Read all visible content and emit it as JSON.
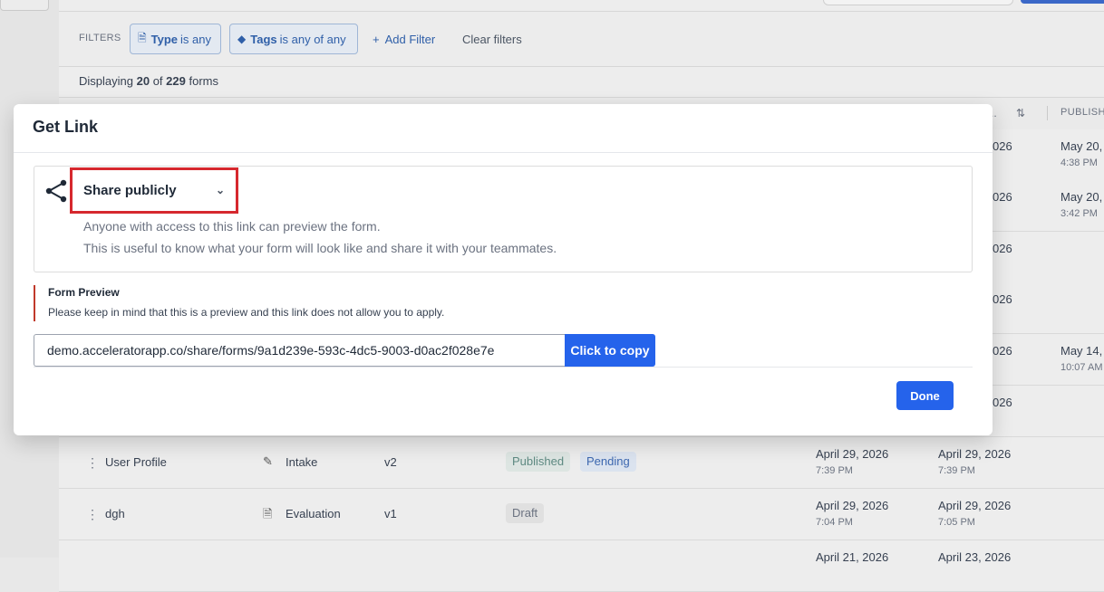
{
  "filters": {
    "label": "FILTERS",
    "type_chip": {
      "key": "Type",
      "rest": "is any",
      "icon": "document-icon"
    },
    "tags_chip": {
      "key": "Tags",
      "rest": "is any of any",
      "icon": "tag-icon"
    },
    "add_filter": "Add Filter",
    "clear_filters": "Clear filters"
  },
  "display": {
    "prefix": "Displaying",
    "shown": "20",
    "of": "of",
    "total": "229",
    "suffix": "forms"
  },
  "table": {
    "truncated_col": "..",
    "publish_col": "PUBLISH",
    "behind_rows": [
      {
        "d2": "026",
        "d3a": "May 20,",
        "d3b": "4:38 PM"
      },
      {
        "d2": "026",
        "d3a": "May 20,",
        "d3b": "3:42 PM"
      },
      {
        "d2": "026",
        "d3a": "",
        "d3b": ""
      },
      {
        "d2": "026",
        "d3a": "",
        "d3b": ""
      },
      {
        "d2": "026",
        "d3a": "May 14,",
        "d3b": "10:07 AM"
      },
      {
        "d2": "026",
        "d3a": "",
        "d3b": ""
      }
    ],
    "rows": [
      {
        "name": "User Profile",
        "type": "Intake",
        "version": "v2",
        "status": "Published",
        "extra": "Pending",
        "created": "April 29, 2026",
        "created_time": "7:39 PM",
        "updated": "April 29, 2026",
        "updated_time": "7:39 PM"
      },
      {
        "name": "dgh",
        "type": "Evaluation",
        "version": "v1",
        "status": "Draft",
        "extra": "",
        "created": "April 29, 2026",
        "created_time": "7:04 PM",
        "updated": "April 29, 2026",
        "updated_time": "7:05 PM"
      },
      {
        "name": "",
        "type": "",
        "version": "",
        "status": "",
        "extra": "",
        "created": "April 21, 2026",
        "created_time": "",
        "updated": "April 23, 2026",
        "updated_time": ""
      }
    ]
  },
  "modal": {
    "title": "Get Link",
    "share_option": "Share publicly",
    "share_desc_1": "Anyone with access to this link can preview the form.",
    "share_desc_2": "This is useful to know what your form will look like and share it with your teammates.",
    "preview_title": "Form Preview",
    "preview_text": "Please keep in mind that this is a preview and this link does not allow you to apply.",
    "link": "demo.acceleratorapp.co/share/forms/9a1d239e-593c-4dc5-9003-d0ac2f028e7e",
    "copy_label": "Click to copy",
    "done_label": "Done"
  },
  "colors": {
    "primary": "#2563eb",
    "highlight": "#d6282e"
  }
}
